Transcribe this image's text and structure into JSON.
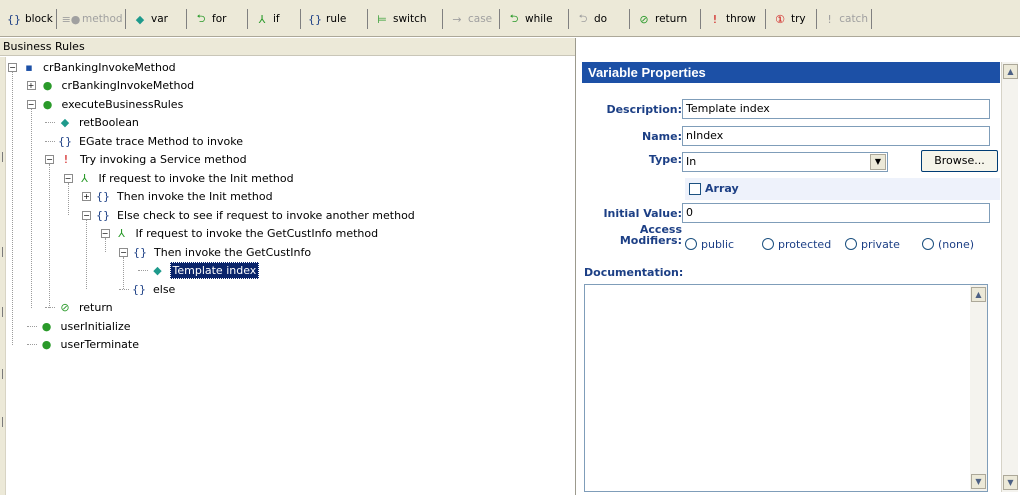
{
  "toolbar": {
    "items": [
      {
        "icon": "braces-icon",
        "glyph": "{}",
        "label": "block",
        "color": "#1c3f85",
        "disabled": false
      },
      {
        "icon": "method-icon",
        "glyph": "≡●",
        "label": "method",
        "color": "#a0a0a0",
        "disabled": true
      },
      {
        "icon": "variable-icon",
        "glyph": "◆",
        "label": "var",
        "color": "#1e9a8c",
        "disabled": false
      },
      {
        "icon": "for-loop-icon",
        "glyph": "⮌",
        "label": "for",
        "color": "#2a9a2a",
        "disabled": false
      },
      {
        "icon": "if-branch-icon",
        "glyph": "⅄",
        "label": "if",
        "color": "#2a9a2a",
        "disabled": false
      },
      {
        "icon": "rule-icon",
        "glyph": "{}",
        "label": "rule",
        "color": "#1c3f85",
        "disabled": false
      },
      {
        "icon": "switch-icon",
        "glyph": "⊨",
        "label": "switch",
        "color": "#2a9a2a",
        "disabled": false
      },
      {
        "icon": "case-icon",
        "glyph": "→",
        "label": "case",
        "color": "#a0a0a0",
        "disabled": true
      },
      {
        "icon": "while-loop-icon",
        "glyph": "⮌",
        "label": "while",
        "color": "#2a9a2a",
        "disabled": false
      },
      {
        "icon": "do-loop-icon",
        "glyph": "⮌",
        "label": "do",
        "color": "#a0a0a0",
        "disabled": false
      },
      {
        "icon": "return-icon",
        "glyph": "⊘",
        "label": "return",
        "color": "#2a9a2a",
        "disabled": false
      },
      {
        "icon": "throw-icon",
        "glyph": "!",
        "label": "throw",
        "color": "#cc0000",
        "disabled": false
      },
      {
        "icon": "try-icon",
        "glyph": "①",
        "label": "try",
        "color": "#cc0000",
        "disabled": false
      },
      {
        "icon": "catch-icon",
        "glyph": "!",
        "label": "catch",
        "color": "#a0a0a0",
        "disabled": true
      }
    ]
  },
  "left_panel": {
    "header": "Business Rules",
    "tree": [
      {
        "label": "crBankingInvokeMethod",
        "icon": "class-icon",
        "glyph": "▪",
        "color": "#1c50a6",
        "expander": "−"
      },
      {
        "label": "crBankingInvokeMethod",
        "icon": "method-icon",
        "glyph": "●",
        "color": "#2a9a2a",
        "expander": "+"
      },
      {
        "label": "executeBusinessRules",
        "icon": "method-icon",
        "glyph": "●",
        "color": "#2a9a2a",
        "expander": "−"
      },
      {
        "label": "retBoolean",
        "icon": "variable-icon",
        "glyph": "◆",
        "color": "#1e9a8c",
        "expander": ""
      },
      {
        "label": "EGate trace Method to invoke",
        "icon": "braces-icon",
        "glyph": "{}",
        "color": "#1c3f85",
        "expander": ""
      },
      {
        "label": "Try invoking a Service method",
        "icon": "try-icon",
        "glyph": "!",
        "color": "#cc0000",
        "expander": "−"
      },
      {
        "label": "If request to invoke the Init method",
        "icon": "if-branch-icon",
        "glyph": "⅄",
        "color": "#2a9a2a",
        "expander": "−"
      },
      {
        "label": "Then invoke the Init method",
        "icon": "braces-icon",
        "glyph": "{}",
        "color": "#1c3f85",
        "expander": "+"
      },
      {
        "label": "Else check to see if request to invoke another method",
        "icon": "braces-icon",
        "glyph": "{}",
        "color": "#1c3f85",
        "expander": "−"
      },
      {
        "label": "If request to invoke the GetCustInfo method",
        "icon": "if-branch-icon",
        "glyph": "⅄",
        "color": "#2a9a2a",
        "expander": "−"
      },
      {
        "label": "Then invoke the GetCustInfo",
        "icon": "braces-icon",
        "glyph": "{}",
        "color": "#1c3f85",
        "expander": "−"
      },
      {
        "label": "Template index",
        "icon": "variable-icon",
        "glyph": "◆",
        "color": "#1e9a8c",
        "expander": "",
        "selected": true
      },
      {
        "label": "else",
        "icon": "braces-icon",
        "glyph": "{}",
        "color": "#1c3f85",
        "expander": ""
      },
      {
        "label": "return",
        "icon": "return-icon",
        "glyph": "⊘",
        "color": "#2a9a2a",
        "expander": ""
      },
      {
        "label": "userInitialize",
        "icon": "method-icon",
        "glyph": "●",
        "color": "#2a9a2a",
        "expander": ""
      },
      {
        "label": "userTerminate",
        "icon": "method-icon",
        "glyph": "●",
        "color": "#2a9a2a",
        "expander": ""
      }
    ]
  },
  "properties": {
    "title": "Variable Properties",
    "description_label": "Description:",
    "description_value": "Template index",
    "name_label": "Name:",
    "name_value": "nIndex",
    "type_label": "Type:",
    "type_value": "In",
    "browse_label": "Browse...",
    "array_label": "Array",
    "array_checked": false,
    "initial_value_label": "Initial Value:",
    "initial_value": "0",
    "access_label_1": "Access",
    "access_label_2": "Modifiers:",
    "access_options": [
      "public",
      "protected",
      "private",
      "(none)"
    ],
    "documentation_label": "Documentation:",
    "documentation_value": ""
  }
}
